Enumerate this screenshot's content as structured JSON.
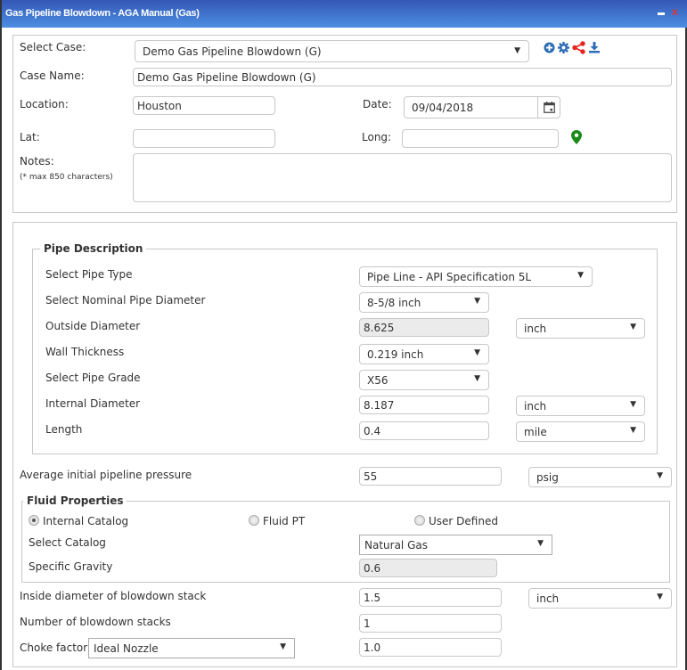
{
  "window": {
    "title": "Gas Pipeline Blowdown - AGA Manual (Gas)",
    "minimize_icon": "minimize-icon",
    "close_icon": "close-icon",
    "close_glyph": "x"
  },
  "case": {
    "select_case_label": "Select Case:",
    "select_case_value": "Demo Gas Pipeline Blowdown (G)",
    "case_name_label": "Case Name:",
    "case_name_value": "Demo Gas Pipeline Blowdown (G)",
    "location_label": "Location:",
    "location_value": "Houston",
    "date_label": "Date:",
    "date_value": "09/04/2018",
    "lat_label": "Lat:",
    "lat_value": "",
    "long_label": "Long:",
    "long_value": "",
    "notes_label": "Notes:",
    "notes_hint": "(* max 850 characters)",
    "notes_value": "",
    "toolbar_icons": [
      "add-circle-icon",
      "gear-icon",
      "share-icon",
      "download-icon"
    ],
    "colors": {
      "toolbar_blue": "#2d6db5",
      "share_red": "#e8231d",
      "map_pin_green": "#1a8a1a"
    }
  },
  "pipe": {
    "legend": "Pipe Description",
    "pipe_type_label": "Select Pipe Type",
    "pipe_type_value": "Pipe Line - API Specification 5L",
    "nominal_diameter_label": "Select Nominal Pipe Diameter",
    "nominal_diameter_value": "8-5/8 inch",
    "outside_diameter_label": "Outside Diameter",
    "outside_diameter_value": "8.625",
    "outside_diameter_unit": "inch",
    "wall_thickness_label": "Wall Thickness",
    "wall_thickness_value": "0.219 inch",
    "pipe_grade_label": "Select Pipe Grade",
    "pipe_grade_value": "X56",
    "internal_diameter_label": "Internal Diameter",
    "internal_diameter_value": "8.187",
    "internal_diameter_unit": "inch",
    "length_label": "Length",
    "length_value": "0.4",
    "length_unit": "mile"
  },
  "pressure": {
    "label": "Average initial pipeline pressure",
    "value": "55",
    "unit": "psig"
  },
  "fluid": {
    "legend": "Fluid Properties",
    "options": [
      {
        "label": "Internal Catalog",
        "checked": true
      },
      {
        "label": "Fluid PT",
        "checked": false
      },
      {
        "label": "User Defined",
        "checked": false
      }
    ],
    "catalog_label": "Select Catalog",
    "catalog_value": "Natural Gas",
    "sg_label": "Specific Gravity",
    "sg_value": "0.6"
  },
  "stack": {
    "inside_diameter_label": "Inside diameter of blowdown stack",
    "inside_diameter_value": "1.5",
    "inside_diameter_unit": "inch",
    "count_label": "Number of blowdown stacks",
    "count_value": "1",
    "choke_label": "Choke factor",
    "choke_type_value": "Ideal Nozzle",
    "choke_value": "1.0"
  },
  "dropdown_glyph": "▼"
}
